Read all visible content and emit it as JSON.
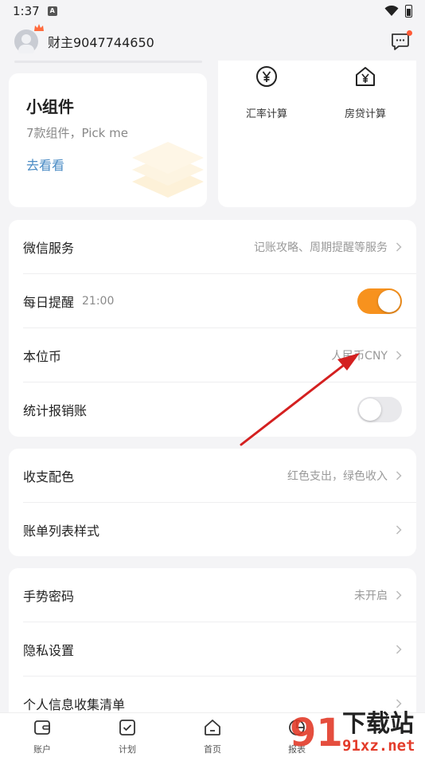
{
  "status": {
    "time": "1:37",
    "badge": "A"
  },
  "header": {
    "username": "财主9047744650"
  },
  "widget": {
    "title": "小组件",
    "subtitle": "7款组件，Pick me",
    "link": "去看看"
  },
  "tools": [
    {
      "label": "汇率计算",
      "icon": "yen-circle-icon"
    },
    {
      "label": "房贷计算",
      "icon": "house-yen-icon"
    }
  ],
  "settings_group1": {
    "wechat": {
      "label": "微信服务",
      "value": "记账攻略、周期提醒等服务"
    },
    "reminder": {
      "label": "每日提醒",
      "time": "21:00",
      "enabled": true
    },
    "currency": {
      "label": "本位币",
      "value": "人民币CNY"
    },
    "reimburse": {
      "label": "统计报销账",
      "enabled": false
    }
  },
  "settings_group2": {
    "color": {
      "label": "收支配色",
      "value": "红色支出，绿色收入"
    },
    "list_style": {
      "label": "账单列表样式"
    }
  },
  "settings_group3": {
    "gesture": {
      "label": "手势密码",
      "value": "未开启"
    },
    "privacy": {
      "label": "隐私设置"
    },
    "info_list": {
      "label": "个人信息收集清单"
    }
  },
  "nav": [
    {
      "label": "账户"
    },
    {
      "label": "计划"
    },
    {
      "label": "首页"
    },
    {
      "label": "报表"
    }
  ],
  "watermark": {
    "brand": "下载站",
    "site": "91xz.net",
    "num": "91"
  },
  "colors": {
    "accent": "#f7921e",
    "link": "#4a8bc4",
    "arrow": "#d42020"
  }
}
